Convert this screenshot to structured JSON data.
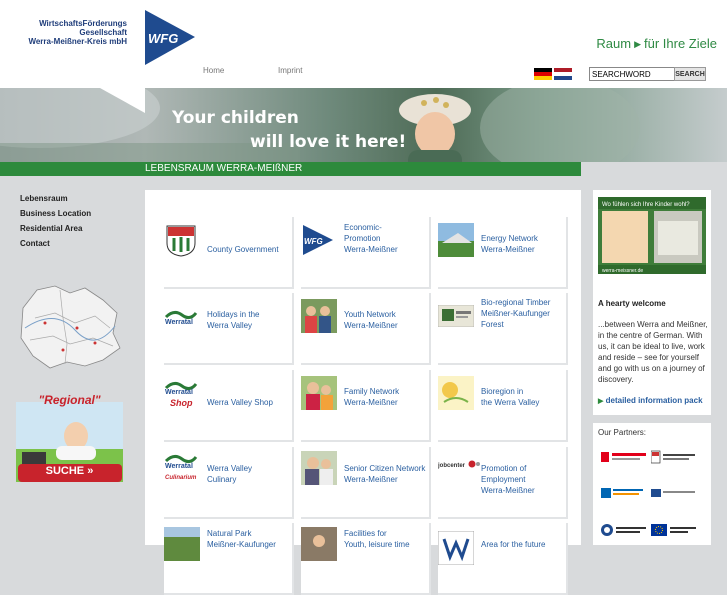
{
  "header": {
    "org_line1": "WirtschaftsFörderungs",
    "org_line2": "Gesellschaft",
    "org_line3": "Werra-Meißner-Kreis mbH",
    "logo_text": "WFG",
    "nav": [
      "Home",
      "Imprint"
    ],
    "tagline_left": "Raum",
    "tagline_right": "für Ihre Ziele",
    "search_value": "SEARCHWORD",
    "search_button": "SEARCH"
  },
  "banner": {
    "headline1": "Your children",
    "headline2": "will love it here!",
    "green_bar": "LEBENSRAUM WERRA-MEIßNER"
  },
  "sidebar": {
    "items": [
      "Lebensraum",
      "Business Location",
      "Residential Area",
      "Contact"
    ],
    "regional_title": "\"Regional\"",
    "regional_button": "SUCHE"
  },
  "tiles": [
    {
      "line1": "County Government",
      "line2": "",
      "line3": ""
    },
    {
      "line1": "Economic-",
      "line2": "Promotion",
      "line3": "Werra-Meißner"
    },
    {
      "line1": "Energy Network",
      "line2": "Werra-Meißner",
      "line3": ""
    },
    {
      "line1": "Holidays in the",
      "line2": "Werra Valley",
      "line3": ""
    },
    {
      "line1": "Youth Network",
      "line2": "Werra-Meißner",
      "line3": ""
    },
    {
      "line1": "Bio-regional Timber",
      "line2": "Meißner-Kaufunger",
      "line3": "Forest"
    },
    {
      "line1": "Werra Valley Shop",
      "line2": "",
      "line3": ""
    },
    {
      "line1": "Family Network",
      "line2": "Werra-Meißner",
      "line3": ""
    },
    {
      "line1": "Bioregion in",
      "line2": "the Werra Valley",
      "line3": ""
    },
    {
      "line1": "Werra Valley",
      "line2": "Culinary",
      "line3": ""
    },
    {
      "line1": "Senior Citizen Network",
      "line2": "Werra-Meißner",
      "line3": ""
    },
    {
      "line1": "Promotion of",
      "line2": "Employment",
      "line3": "Werra-Meißner"
    },
    {
      "line1": "Natural Park",
      "line2": "Meißner-Kaufunger",
      "line3": ""
    },
    {
      "line1": "Facilities for",
      "line2": "Youth, leisure time",
      "line3": ""
    },
    {
      "line1": "Area for the future",
      "line2": "",
      "line3": ""
    }
  ],
  "tile_icon_text": {
    "werratal": "Werratal",
    "shop": "Shop",
    "culinarium": "Culinarium",
    "jobcenter": "jobcenter"
  },
  "right": {
    "promo_text": "Wo fühlen sich Ihre Kinder wohl?",
    "promo_url": "werra-meissner.de",
    "welcome_title": "A hearty welcome",
    "welcome_text": "...between Werra and Meißner, in the centre of German. With us, it can be ideal to live, work and reside – see for yourself and go with us on a journey of discovery.",
    "detail_link": "detailed information pack",
    "partners_title": "Our Partners:"
  },
  "colors": {
    "green": "#2d8a3c",
    "blue_link": "#2a5fa0",
    "navy": "#1f3d7a"
  }
}
